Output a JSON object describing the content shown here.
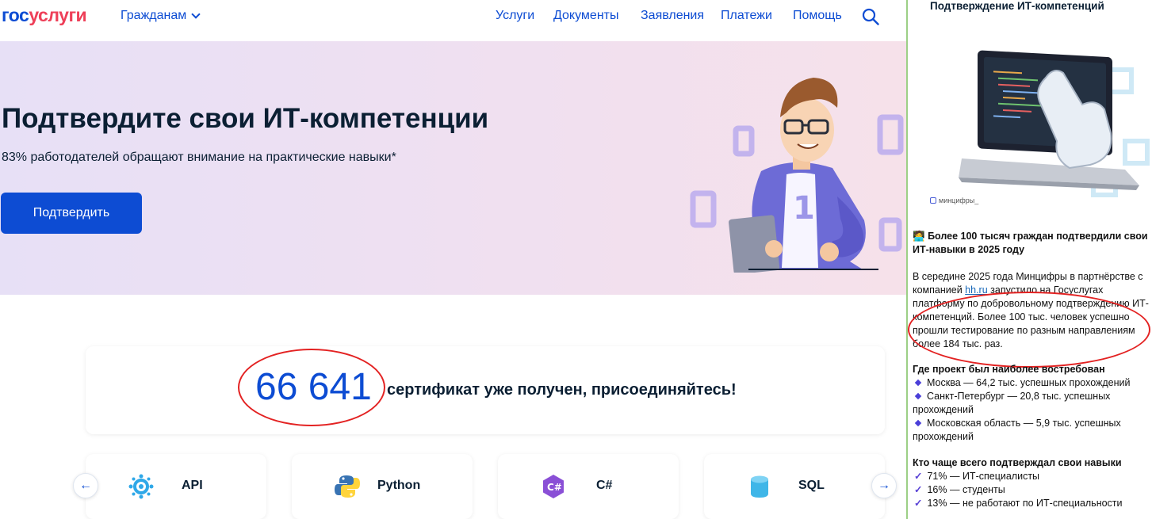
{
  "header": {
    "logo_part1": "гос",
    "logo_part2": "услуги",
    "citizens_label": "Гражданам",
    "nav": [
      "Услуги",
      "Документы",
      "Заявления",
      "Платежи",
      "Помощь"
    ]
  },
  "hero": {
    "title": "Подтвердите свои ИТ-компетенции",
    "subtitle": "83% работодателей обращают внимание на практические навыки*",
    "button": "Подтвердить"
  },
  "stats": {
    "number": "66 641",
    "text": "сертификат уже получен, присоединяйтесь!"
  },
  "cards": [
    {
      "label": "API",
      "icon": "api-icon"
    },
    {
      "label": "Python",
      "icon": "python-icon"
    },
    {
      "label": "C#",
      "icon": "csharp-icon"
    },
    {
      "label": "SQL",
      "icon": "sql-icon"
    }
  ],
  "carousel": {
    "prev": "←",
    "next": "→"
  },
  "panel": {
    "title": "Подтверждение ИТ-компетенций",
    "image_caption": "минцифры_",
    "headline": "Более 100 тысяч граждан подтвердили свои ИТ-навыки в 2025 году",
    "body_part1": "В середине 2025 года Минцифры в партнёрстве с компанией ",
    "body_link": "hh.ru",
    "body_part2": " запустило на Госуслугах платформу по добровольному подтверждению ИТ-компетенций. Более 100 тыс. человек успешно прошли тестирование по разным направлениям более 184 тыс. раз.",
    "regions_title": "Где проект был наиболее востребован",
    "regions": [
      "Москва — 64,2 тыс. успешных прохождений",
      "Санкт-Петербург — 20,8 тыс. успешных прохождений",
      "Московская область — 5,9 тыс. успешных прохождений"
    ],
    "who_title": "Кто чаще всего подтверждал свои навыки",
    "who": [
      "71% — ИТ-специалисты",
      "16% — студенты",
      "13% — не работают по ИТ-специальности"
    ]
  },
  "colors": {
    "brand_blue": "#0d4cd3",
    "brand_red": "#ee3f58",
    "annotation_red": "#e32222"
  }
}
